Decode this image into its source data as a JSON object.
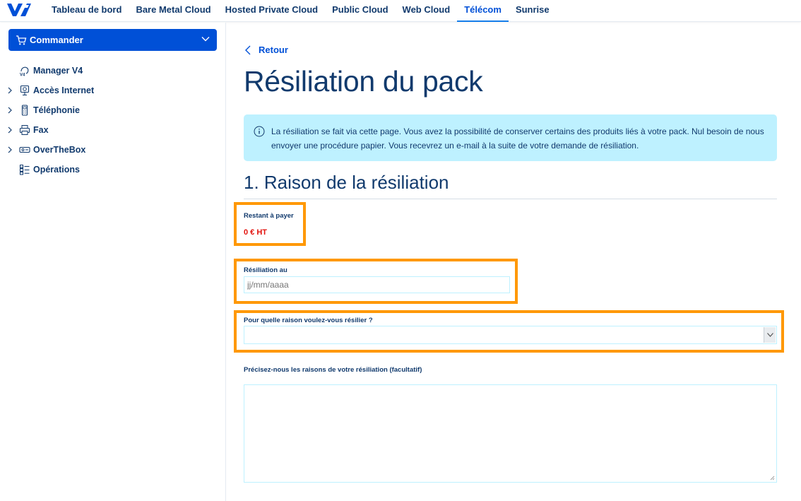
{
  "nav": {
    "logo": "ovh-logo",
    "items": [
      {
        "label": "Tableau de bord",
        "active": false
      },
      {
        "label": "Bare Metal Cloud",
        "active": false
      },
      {
        "label": "Hosted Private Cloud",
        "active": false
      },
      {
        "label": "Public Cloud",
        "active": false
      },
      {
        "label": "Web Cloud",
        "active": false
      },
      {
        "label": "Télécom",
        "active": true
      },
      {
        "label": "Sunrise",
        "active": false
      }
    ]
  },
  "sidebar": {
    "order_button": "Commander",
    "items": [
      {
        "label": "Manager V4",
        "icon": "manager-v4-icon",
        "expandable": false
      },
      {
        "label": "Accès Internet",
        "icon": "internet-access-icon",
        "expandable": true
      },
      {
        "label": "Téléphonie",
        "icon": "phone-icon",
        "expandable": true
      },
      {
        "label": "Fax",
        "icon": "fax-icon",
        "expandable": true
      },
      {
        "label": "OverTheBox",
        "icon": "overthebox-icon",
        "expandable": true
      },
      {
        "label": "Opérations",
        "icon": "operations-icon",
        "expandable": false
      }
    ]
  },
  "main": {
    "back_label": "Retour",
    "title": "Résiliation du pack",
    "info": "La résiliation se fait via cette page. Vous avez la possibilité de conserver certains des produits liés à votre pack. Nul besoin de nous envoyer une procédure papier. Vous recevrez un e-mail à la suite de votre demande de résiliation.",
    "section_title": "1. Raison de la résiliation",
    "remaining": {
      "label": "Restant à payer",
      "value": "0 € HT"
    },
    "date_field": {
      "label": "Résiliation au",
      "placeholder": "jj/mm/aaaa"
    },
    "reason_field": {
      "label": "Pour quelle raison voulez-vous résilier ?",
      "value": ""
    },
    "details_field": {
      "label": "Précisez-nous les raisons de votre résiliation (facultatif)",
      "value": ""
    }
  },
  "colors": {
    "primary": "#0050d7",
    "info_bg": "#bef1ff",
    "highlight": "#ff9803",
    "amount": "#e2120d"
  }
}
